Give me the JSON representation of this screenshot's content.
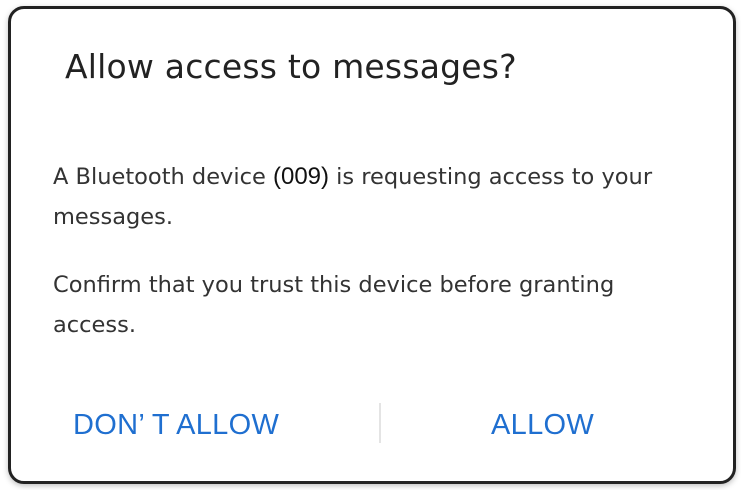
{
  "dialog": {
    "title": "Allow access to messages?",
    "body1": {
      "before": "A Bluetooth device ",
      "device_id": "(009)",
      "after": " is requesting access to your messages."
    },
    "body2": "Confirm that you trust this device before granting access.",
    "deny_label": "DON’ T ALLOW",
    "allow_label": "ALLOW"
  },
  "colors": {
    "accent": "#1f6fd0",
    "text": "#333333",
    "divider": "#e4e4e4"
  }
}
